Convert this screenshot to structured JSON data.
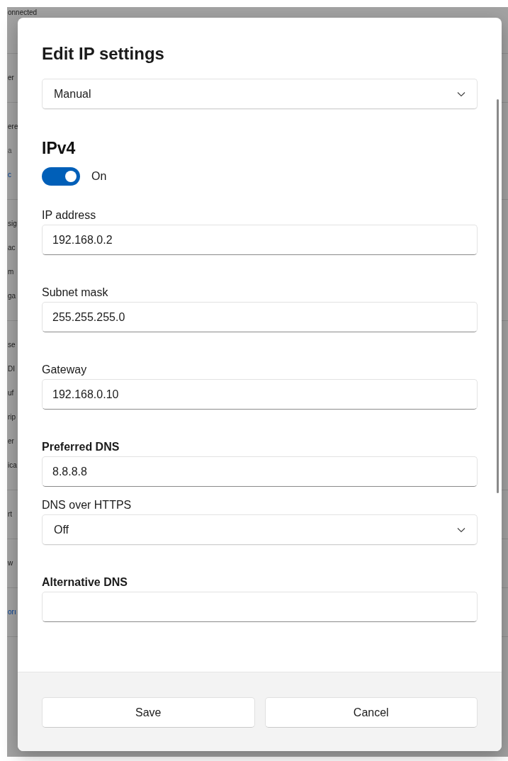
{
  "background": {
    "groups": [
      {
        "lines": [
          {
            "text": "onnected",
            "kind": "text"
          }
        ]
      },
      {
        "lines": [
          {
            "text": "er",
            "kind": "text"
          }
        ]
      },
      {
        "lines": [
          {
            "text": "ere",
            "kind": "text"
          },
          {
            "text": "a",
            "kind": "subtext"
          },
          {
            "text": "c",
            "kind": "link"
          }
        ]
      },
      {
        "lines": [
          {
            "text": "sig",
            "kind": "text"
          },
          {
            "text": "ac",
            "kind": "text"
          },
          {
            "text": "m",
            "kind": "text"
          },
          {
            "text": "ga",
            "kind": "text"
          }
        ]
      },
      {
        "lines": [
          {
            "text": "se",
            "kind": "text"
          },
          {
            "text": "DI",
            "kind": "text"
          },
          {
            "text": "uf",
            "kind": "text"
          },
          {
            "text": "rip",
            "kind": "text"
          },
          {
            "text": "er",
            "kind": "text"
          },
          {
            "text": "ica",
            "kind": "text"
          }
        ]
      },
      {
        "lines": [
          {
            "text": "rt",
            "kind": "text"
          }
        ]
      },
      {
        "lines": [
          {
            "text": "w",
            "kind": "text"
          }
        ]
      },
      {
        "lines": [
          {
            "text": "orı",
            "kind": "link"
          }
        ]
      }
    ]
  },
  "dialog": {
    "title": "Edit IP settings",
    "mode_select": {
      "value": "Manual"
    },
    "section": {
      "title": "IPv4",
      "toggle": {
        "on": true,
        "label": "On"
      }
    },
    "fields": [
      {
        "kind": "input",
        "label": "IP address",
        "bold": false,
        "value": "192.168.0.2"
      },
      {
        "kind": "input",
        "label": "Subnet mask",
        "bold": false,
        "value": "255.255.255.0"
      },
      {
        "kind": "input",
        "label": "Gateway",
        "bold": false,
        "value": "192.168.0.10"
      },
      {
        "kind": "input",
        "label": "Preferred DNS",
        "bold": true,
        "value": "8.8.8.8"
      },
      {
        "kind": "select",
        "label": "DNS over HTTPS",
        "bold": false,
        "value": "Off"
      },
      {
        "kind": "input",
        "label": "Alternative DNS",
        "bold": true
      }
    ],
    "buttons": [
      {
        "label": "Save"
      },
      {
        "label": "Cancel"
      }
    ]
  }
}
